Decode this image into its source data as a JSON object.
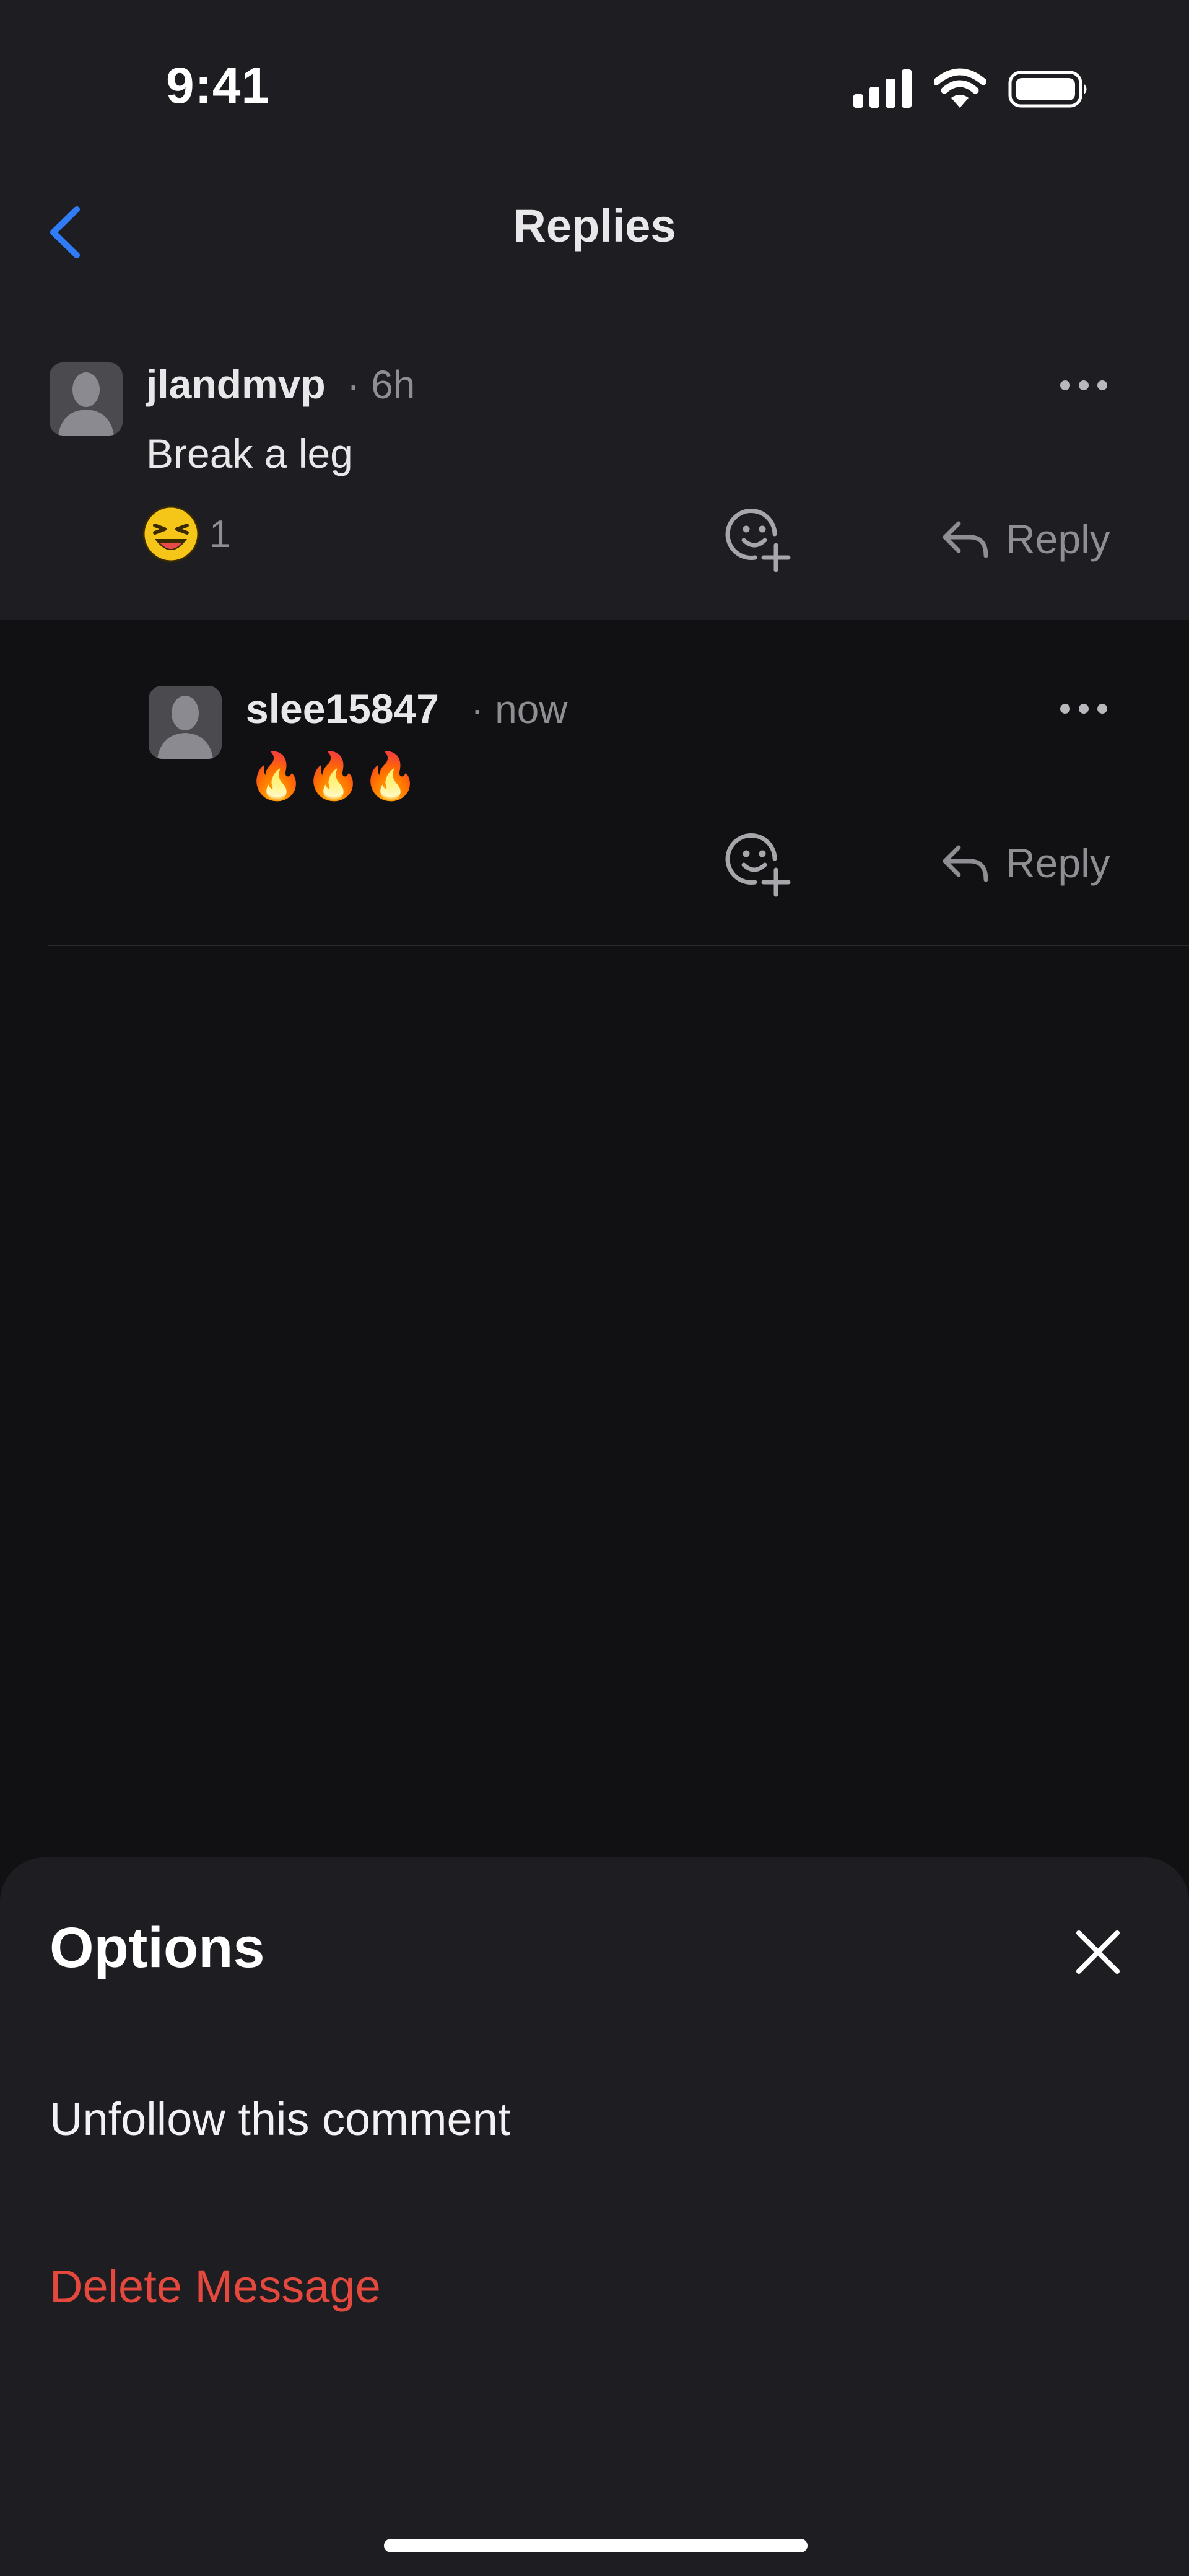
{
  "status_bar": {
    "time": "9:41"
  },
  "header": {
    "title": "Replies"
  },
  "comments": [
    {
      "username": "jlandmvp",
      "meta": "· 6h",
      "body": "Break a leg",
      "reaction": {
        "emoji": "😆",
        "count": "1"
      },
      "reply_label": "Reply"
    },
    {
      "username": "slee15847",
      "meta": "· now",
      "body": "🔥🔥🔥",
      "reply_label": "Reply"
    }
  ],
  "sheet": {
    "title": "Options",
    "options": [
      {
        "label": "Unfollow this comment"
      },
      {
        "label": "Delete Message"
      }
    ]
  },
  "colors": {
    "accent_blue": "#2f7cf6",
    "danger_red": "#e5483d",
    "sheet_bg": "#1d1d22",
    "screen_bg": "#111113"
  },
  "icons": [
    "signal-icon",
    "wifi-icon",
    "battery-icon",
    "back-chevron-icon",
    "more-icon",
    "add-reaction-icon",
    "reply-arrow-icon",
    "close-icon"
  ]
}
